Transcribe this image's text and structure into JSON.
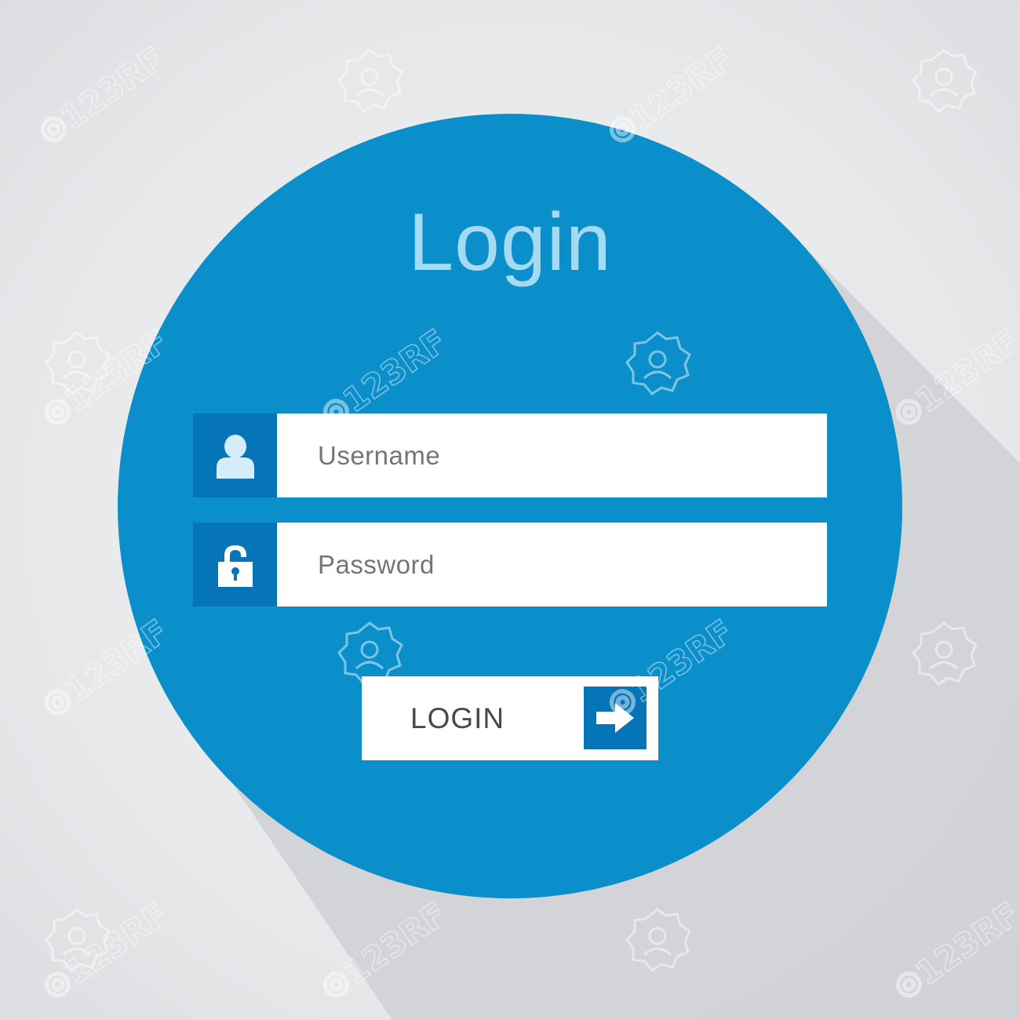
{
  "page": {
    "title": "Login",
    "background_color": "#e6e7e9",
    "circle_color": "#0a8fcb",
    "accent_color": "#0675b8",
    "title_color": "#a4daf2"
  },
  "form": {
    "username": {
      "placeholder": "Username",
      "icon": "user-icon"
    },
    "password": {
      "placeholder": "Password",
      "icon": "lock-icon"
    },
    "submit": {
      "label": "LOGIN",
      "icon": "arrow-right-icon"
    }
  },
  "watermark": {
    "text": "123RF"
  }
}
